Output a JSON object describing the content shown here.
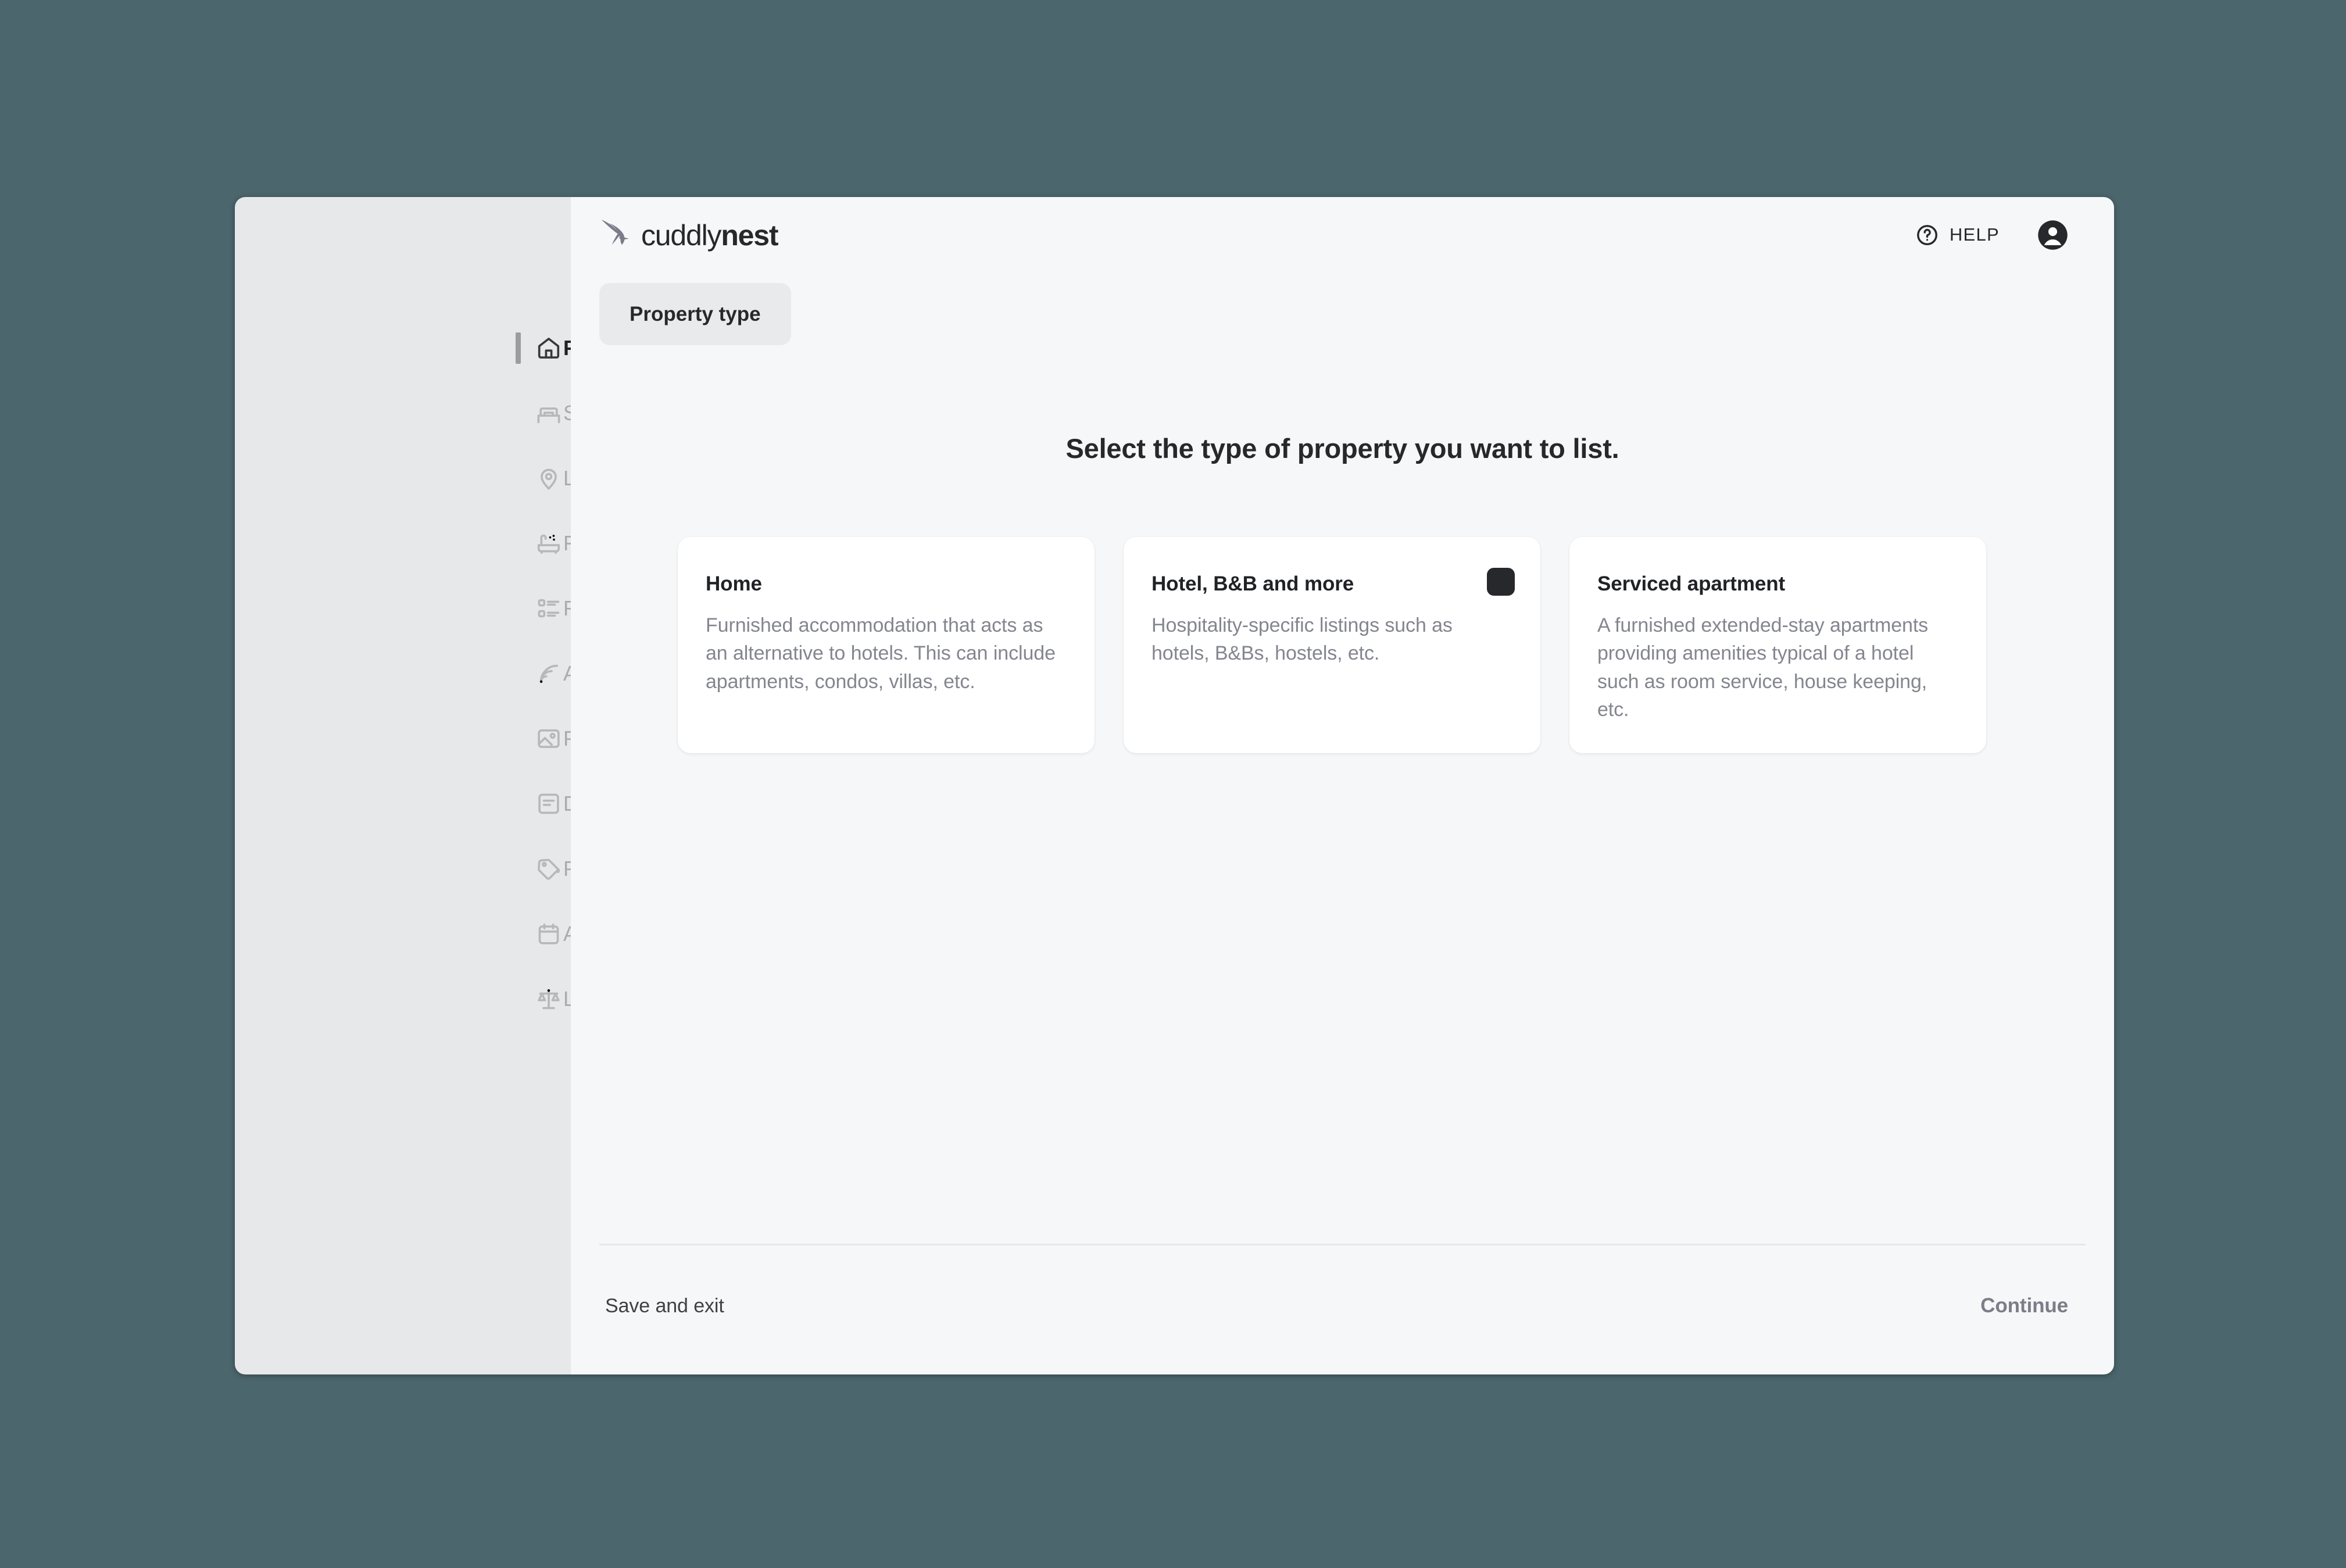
{
  "brand": {
    "logo_icon": "hummingbird-icon",
    "name_light": "cuddly",
    "name_bold": "nest"
  },
  "header": {
    "help_label": "HELP",
    "help_icon": "question-circle-icon",
    "account_icon": "account-avatar-icon"
  },
  "sidebar": {
    "items": [
      {
        "label": "Property type",
        "icon": "home-icon",
        "active": true
      },
      {
        "label": "Sleeping",
        "icon": "bed-icon",
        "active": false
      },
      {
        "label": "Location",
        "icon": "map-pin-icon",
        "active": false
      },
      {
        "label": "Facilities",
        "icon": "bathtub-icon",
        "active": false
      },
      {
        "label": "Rules",
        "icon": "list-icon",
        "active": false
      },
      {
        "label": "Amenities",
        "icon": "wifi-icon",
        "active": false
      },
      {
        "label": "Photos",
        "icon": "image-icon",
        "active": false
      },
      {
        "label": "Description",
        "icon": "document-icon",
        "active": false
      },
      {
        "label": "Pricing",
        "icon": "price-tag-icon",
        "active": false
      },
      {
        "label": "Availability",
        "icon": "calendar-icon",
        "active": false
      },
      {
        "label": "Local regulations",
        "icon": "scales-icon",
        "active": false
      }
    ]
  },
  "main": {
    "tab_label": "Property type",
    "heading": "Select the type of property you want to list.",
    "cards": [
      {
        "title": "Home",
        "description": "Furnished accommodation that acts as an alternative to hotels. This can include apartments, condos, villas, etc.",
        "selected": false
      },
      {
        "title": "Hotel, B&B and more",
        "description": "Hospitality-specific listings such as hotels, B&Bs, hostels, etc.",
        "selected": true
      },
      {
        "title": "Serviced apartment",
        "description": "A furnished extended-stay apartments providing amenities typical of a hotel such as room service, house keeping, etc.",
        "selected": false
      }
    ]
  },
  "footer": {
    "save_exit_label": "Save and exit",
    "continue_label": "Continue"
  },
  "colors": {
    "page_background": "#4c666e",
    "sidebar_background": "#e7e8ea",
    "main_background": "#f6f7f8",
    "card_background": "#ffffff",
    "text_primary": "#26282b",
    "text_muted": "#a9abae",
    "selected_badge": "#26282b"
  }
}
